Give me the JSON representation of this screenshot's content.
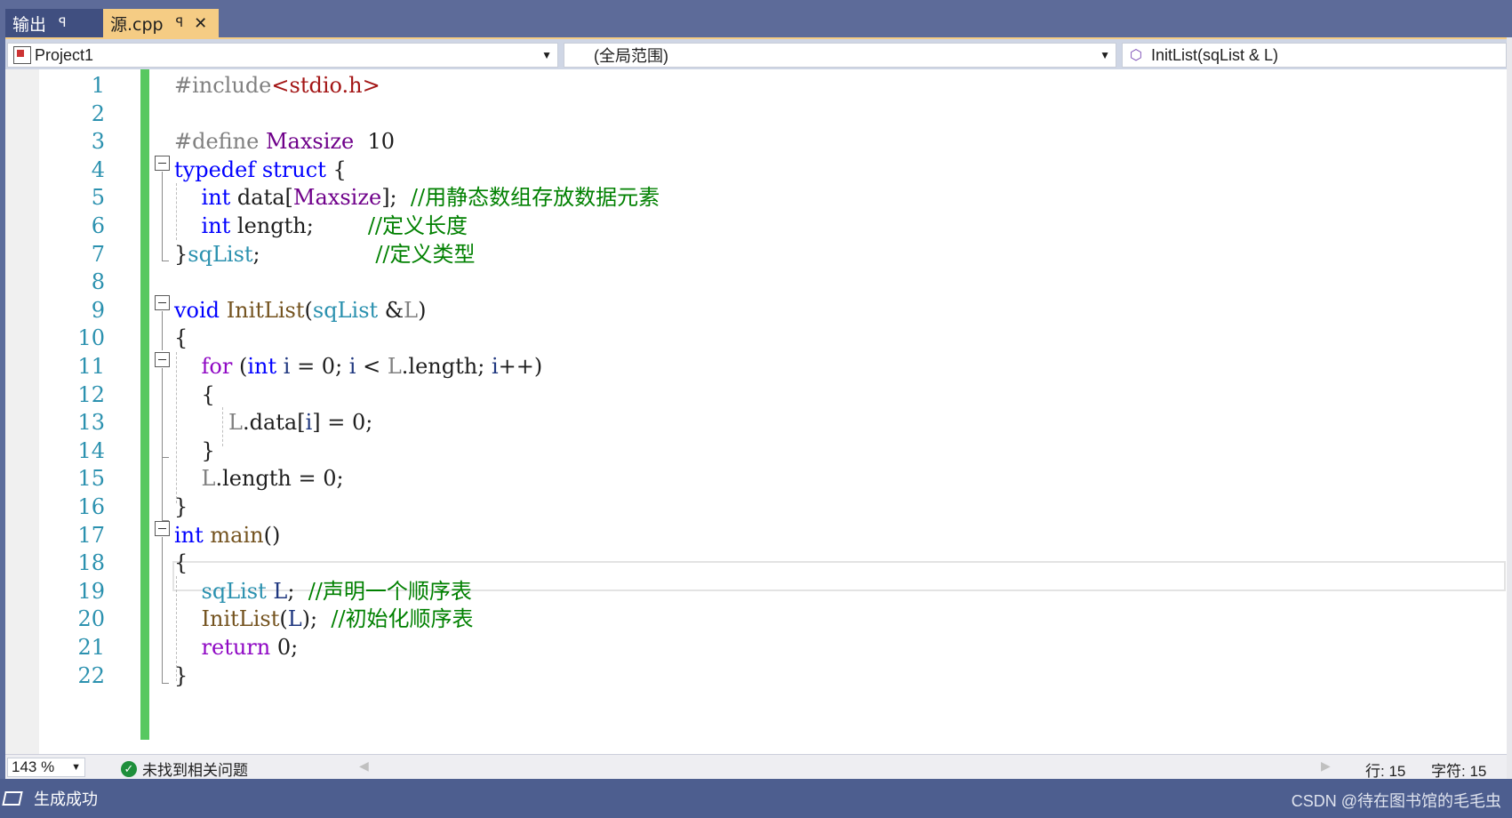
{
  "tabs": {
    "output_label": "输出",
    "source_label": "源.cpp",
    "pin_glyph": "ꟼ",
    "close_glyph": "✕"
  },
  "nav": {
    "project": "Project1",
    "scope": "(全局范围)",
    "member": "InitList(sqList & L)"
  },
  "editor": {
    "line_numbers": [
      "1",
      "2",
      "3",
      "4",
      "5",
      "6",
      "7",
      "8",
      "9",
      "10",
      "11",
      "12",
      "13",
      "14",
      "15",
      "16",
      "17",
      "18",
      "19",
      "20",
      "21",
      "22"
    ],
    "lines": [
      [
        [
          "pp",
          "#include"
        ],
        [
          "str",
          "<stdio.h>"
        ]
      ],
      [],
      [
        [
          "pp",
          "#define "
        ],
        [
          "mac",
          "Maxsize"
        ],
        [
          "",
          "  10"
        ]
      ],
      [
        [
          "kw",
          "typedef"
        ],
        [
          "",
          " "
        ],
        [
          "kw",
          "struct"
        ],
        [
          "",
          " {"
        ]
      ],
      [
        [
          "",
          "    "
        ],
        [
          "kw",
          "int"
        ],
        [
          "",
          " data["
        ],
        [
          "mac",
          "Maxsize"
        ],
        [
          "",
          "];  "
        ],
        [
          "cm",
          "//用静态数组存放数据元素"
        ]
      ],
      [
        [
          "",
          "    "
        ],
        [
          "kw",
          "int"
        ],
        [
          "",
          " length;        "
        ],
        [
          "cm",
          "//定义长度"
        ]
      ],
      [
        [
          "",
          "}"
        ],
        [
          "ty",
          "sqList"
        ],
        [
          "",
          ";                 "
        ],
        [
          "cm",
          "//定义类型"
        ]
      ],
      [],
      [
        [
          "kw",
          "void"
        ],
        [
          "",
          " "
        ],
        [
          "fn",
          "InitList"
        ],
        [
          "",
          "("
        ],
        [
          "ty",
          "sqList"
        ],
        [
          "",
          " &"
        ],
        [
          "pa",
          "L"
        ],
        [
          "",
          ")"
        ]
      ],
      [
        [
          "",
          "{"
        ]
      ],
      [
        [
          "",
          "    "
        ],
        [
          "kw2",
          "for"
        ],
        [
          "",
          " ("
        ],
        [
          "kw",
          "int"
        ],
        [
          "",
          " "
        ],
        [
          "va",
          "i"
        ],
        [
          "",
          " = 0; "
        ],
        [
          "va",
          "i"
        ],
        [
          "",
          " < "
        ],
        [
          "pa",
          "L"
        ],
        [
          "",
          ".length; "
        ],
        [
          "va",
          "i"
        ],
        [
          "",
          "++)"
        ]
      ],
      [
        [
          "",
          "    {"
        ]
      ],
      [
        [
          "",
          "        "
        ],
        [
          "pa",
          "L"
        ],
        [
          "",
          ".data["
        ],
        [
          "va",
          "i"
        ],
        [
          "",
          "] = 0;"
        ]
      ],
      [
        [
          "",
          "    }"
        ]
      ],
      [
        [
          "",
          "    "
        ],
        [
          "pa",
          "L"
        ],
        [
          "",
          ".length = 0;"
        ]
      ],
      [
        [
          "",
          "}"
        ]
      ],
      [
        [
          "kw",
          "int"
        ],
        [
          "",
          " "
        ],
        [
          "fn",
          "main"
        ],
        [
          "",
          "()"
        ]
      ],
      [
        [
          "",
          "{"
        ]
      ],
      [
        [
          "",
          "    "
        ],
        [
          "ty",
          "sqList"
        ],
        [
          "",
          " "
        ],
        [
          "va",
          "L"
        ],
        [
          "",
          ";  "
        ],
        [
          "cm",
          "//声明一个顺序表"
        ]
      ],
      [
        [
          "",
          "    "
        ],
        [
          "fn",
          "InitList"
        ],
        [
          "",
          "("
        ],
        [
          "va",
          "L"
        ],
        [
          "",
          ");  "
        ],
        [
          "cm",
          "//初始化顺序表"
        ]
      ],
      [
        [
          "",
          "    "
        ],
        [
          "kw2",
          "return"
        ],
        [
          "",
          " 0;"
        ]
      ],
      [
        [
          "",
          "}"
        ]
      ]
    ]
  },
  "status": {
    "zoom": "143 %",
    "issues": "未找到相关问题",
    "line": "行: 15",
    "char": "字符: 15"
  },
  "appbar": {
    "build_status": "生成成功",
    "watermark": "CSDN @待在图书馆的毛毛虫"
  },
  "colors": {
    "keyword": "#0000ff",
    "type": "#2b91af",
    "macro": "#6f008a",
    "string": "#a31515",
    "comment": "#008000",
    "function": "#74531f",
    "control": "#8f08c4",
    "change_bar": "#57c860",
    "active_tab": "#f5cc84"
  }
}
